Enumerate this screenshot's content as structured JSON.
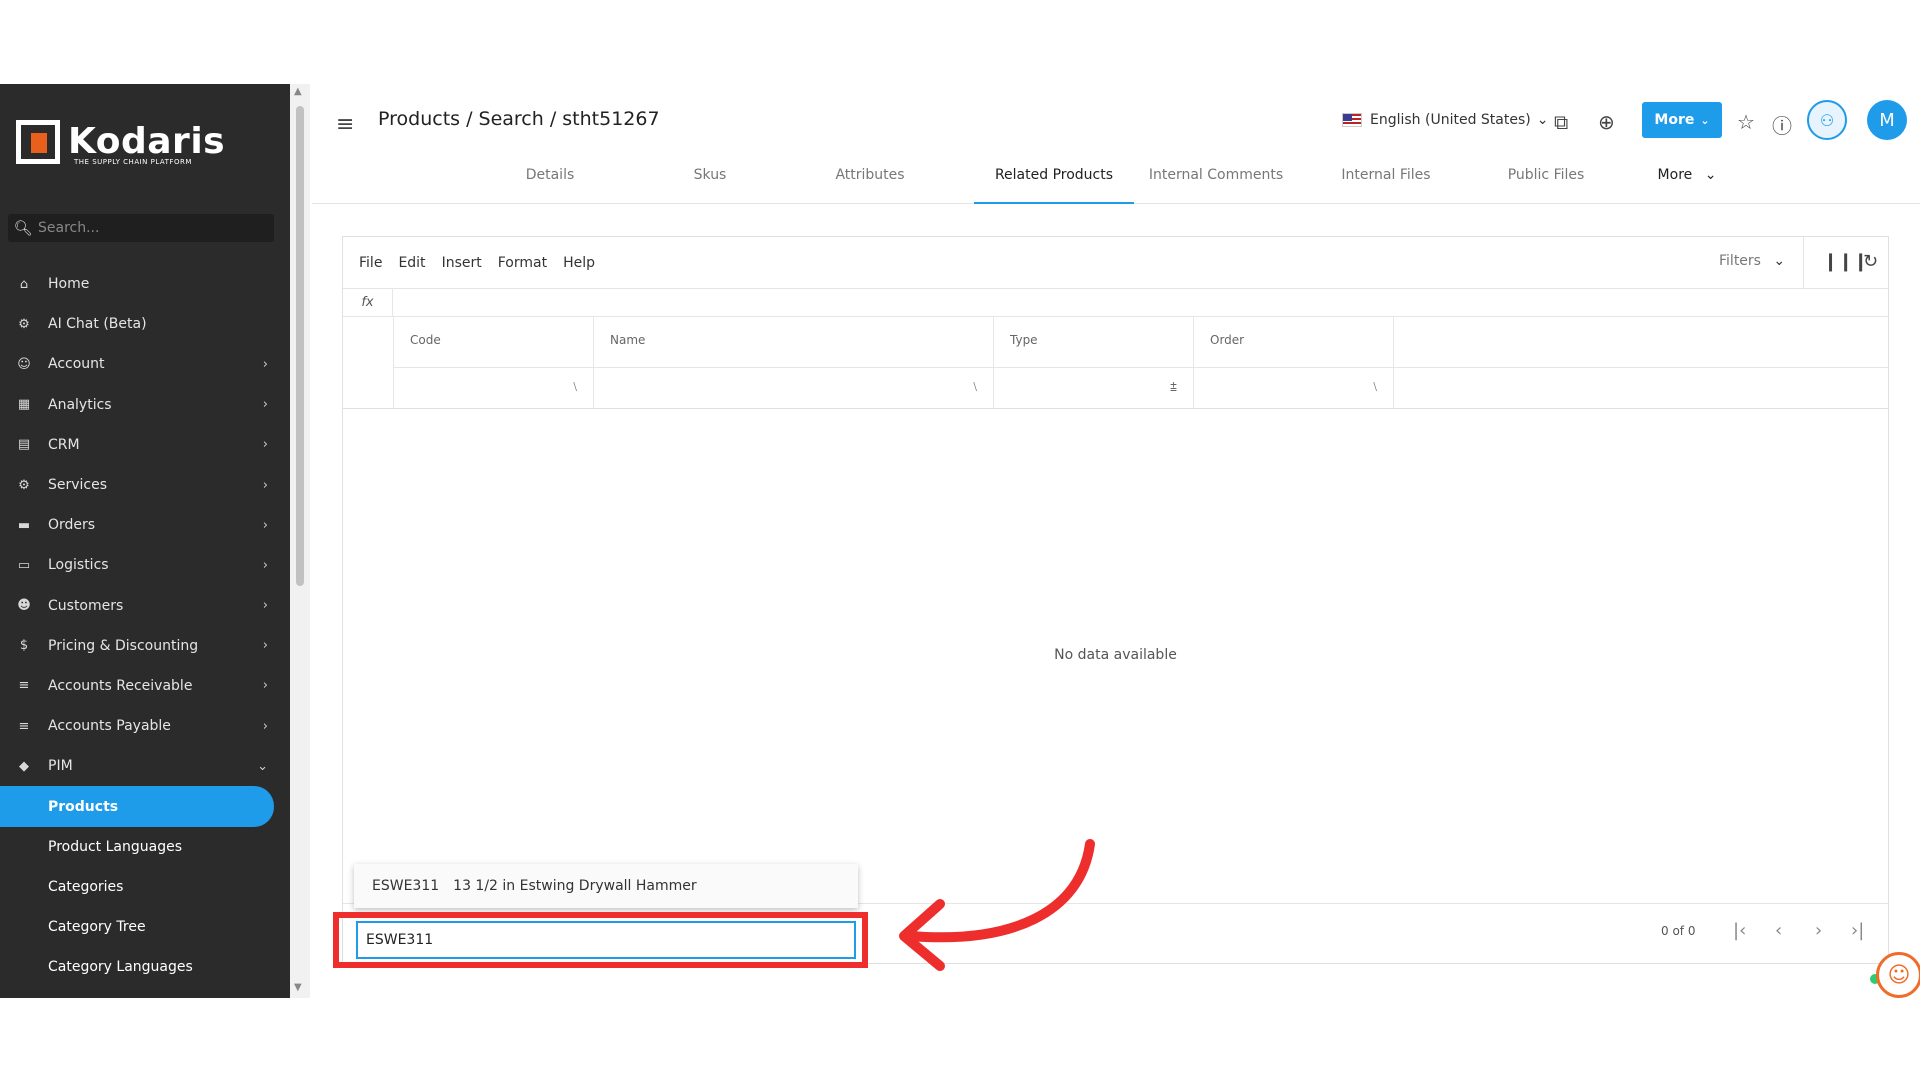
{
  "sidebar": {
    "logo_text": "Kodaris",
    "logo_sub": "THE SUPPLY CHAIN PLATFORM",
    "search_placeholder": "Search...",
    "items": [
      {
        "label": "Home",
        "icon": "home-icon"
      },
      {
        "label": "AI Chat (Beta)",
        "icon": "robot-icon"
      },
      {
        "label": "Account",
        "icon": "user-icon"
      },
      {
        "label": "Analytics",
        "icon": "chart-icon"
      },
      {
        "label": "CRM",
        "icon": "contact-card-icon"
      },
      {
        "label": "Services",
        "icon": "gears-icon"
      },
      {
        "label": "Orders",
        "icon": "truck-icon"
      },
      {
        "label": "Logistics",
        "icon": "shipping-icon"
      },
      {
        "label": "Customers",
        "icon": "users-icon"
      },
      {
        "label": "Pricing & Discounting",
        "icon": "dollar-icon"
      },
      {
        "label": "Accounts Receivable",
        "icon": "bank-icon"
      },
      {
        "label": "Accounts Payable",
        "icon": "bank-icon"
      },
      {
        "label": "PIM",
        "icon": "tag-icon"
      }
    ],
    "sub_items": [
      {
        "label": "Products",
        "active": true
      },
      {
        "label": "Product Languages"
      },
      {
        "label": "Categories"
      },
      {
        "label": "Category Tree"
      },
      {
        "label": "Category Languages"
      }
    ]
  },
  "header": {
    "breadcrumb": "Products / Search / stht51267",
    "language": "English (United States)",
    "more_label": "More",
    "avatar_initial": "M",
    "accent_color": "#1e9be9"
  },
  "tabs": [
    {
      "label": "Details"
    },
    {
      "label": "Skus"
    },
    {
      "label": "Attributes"
    },
    {
      "label": "Related Products",
      "active": true
    },
    {
      "label": "Internal Comments"
    },
    {
      "label": "Internal Files"
    },
    {
      "label": "Public Files"
    },
    {
      "label": "More"
    }
  ],
  "grid": {
    "menu": [
      "File",
      "Edit",
      "Insert",
      "Format",
      "Help"
    ],
    "filters_label": "Filters",
    "fx_label": "fx",
    "columns": [
      "Code",
      "Name",
      "Type",
      "Order"
    ],
    "empty_text": "No data available",
    "pager_text": "0 of 0"
  },
  "autocomplete": {
    "code": "ESWE311",
    "description": "13 1/2 in Estwing Drywall Hammer",
    "input_value": "ESWE311"
  },
  "annotation": {
    "box_color": "#ee2d2d"
  }
}
